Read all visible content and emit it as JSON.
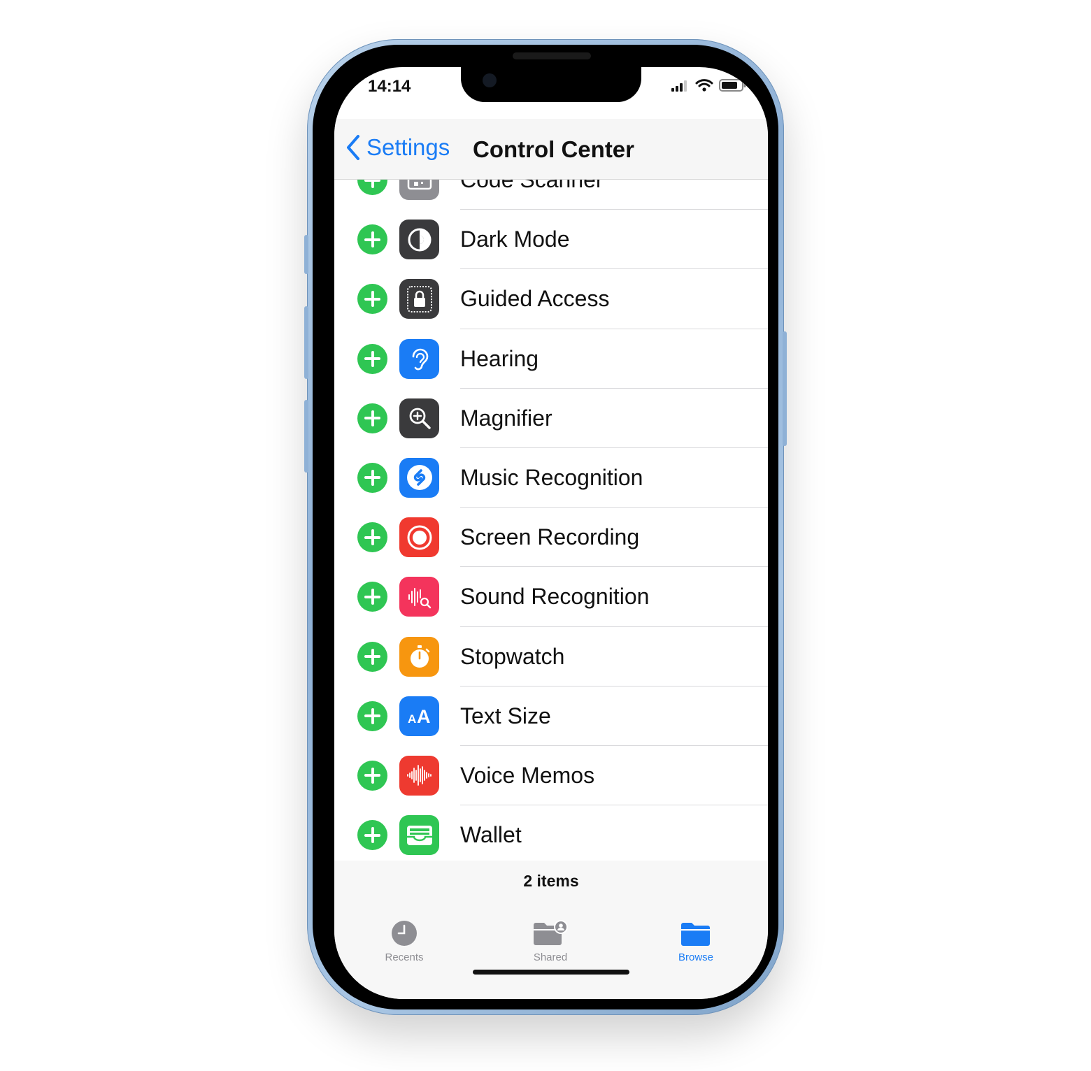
{
  "status_bar": {
    "time": "14:14"
  },
  "nav": {
    "back_label": "Settings",
    "title": "Control Center"
  },
  "items": [
    {
      "label": "Code Scanner",
      "icon": "qr-code-icon",
      "color": "#8e8e93"
    },
    {
      "label": "Dark Mode",
      "icon": "dark-mode-icon",
      "color": "#3a3a3c"
    },
    {
      "label": "Guided Access",
      "icon": "guided-access-icon",
      "color": "#3a3a3c"
    },
    {
      "label": "Hearing",
      "icon": "ear-icon",
      "color": "#1a7cf5"
    },
    {
      "label": "Magnifier",
      "icon": "magnifier-icon",
      "color": "#3a3a3c"
    },
    {
      "label": "Music Recognition",
      "icon": "shazam-icon",
      "color": "#1a7cf5"
    },
    {
      "label": "Screen Recording",
      "icon": "record-icon",
      "color": "#f0392f"
    },
    {
      "label": "Sound Recognition",
      "icon": "sound-recognition-icon",
      "color": "#f4345c"
    },
    {
      "label": "Stopwatch",
      "icon": "stopwatch-icon",
      "color": "#f7960f"
    },
    {
      "label": "Text Size",
      "icon": "text-size-icon",
      "color": "#1a7cf5"
    },
    {
      "label": "Voice Memos",
      "icon": "waveform-icon",
      "color": "#ee3a30"
    },
    {
      "label": "Wallet",
      "icon": "wallet-icon",
      "color": "#2fc653"
    }
  ],
  "footer": {
    "count_text": "2 items"
  },
  "tabs": [
    {
      "label": "Recents",
      "icon": "clock-icon",
      "active": false
    },
    {
      "label": "Shared",
      "icon": "shared-folder-icon",
      "active": false
    },
    {
      "label": "Browse",
      "icon": "folder-icon",
      "active": true
    }
  ],
  "colors": {
    "accent": "#1a7cf5",
    "add_green": "#2fc653",
    "inactive_tab": "#8e8e93"
  }
}
